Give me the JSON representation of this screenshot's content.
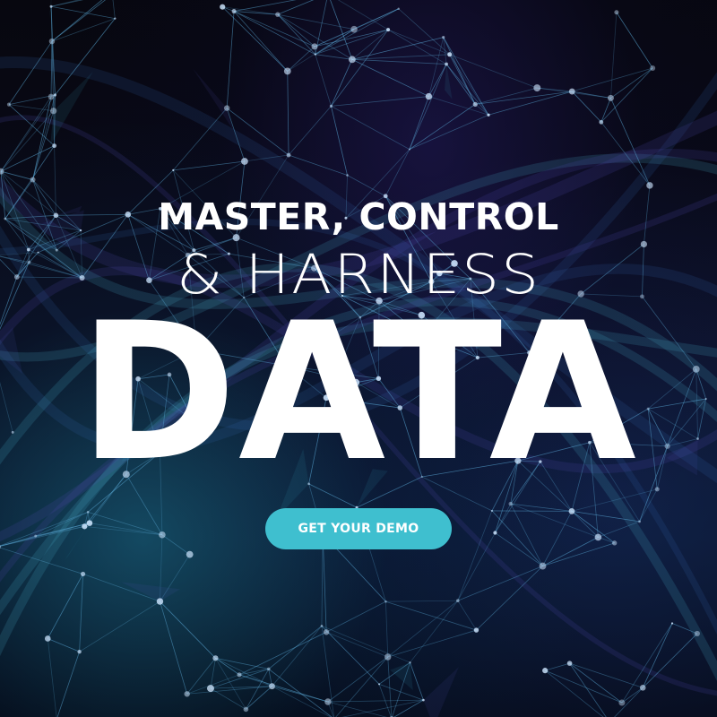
{
  "hero": {
    "line1": "MASTER, CONTROL",
    "line2": "& HARNESS",
    "line3": "DATA",
    "cta_label": "GET YOUR DEMO"
  },
  "colors": {
    "background": "#05060d",
    "text": "#ffffff",
    "cta": "#3fbfcf",
    "network_lines": "#5aa9d6",
    "network_nodes": "#cfe6ff"
  },
  "background_image": {
    "icon": "network-graph-illustration"
  }
}
